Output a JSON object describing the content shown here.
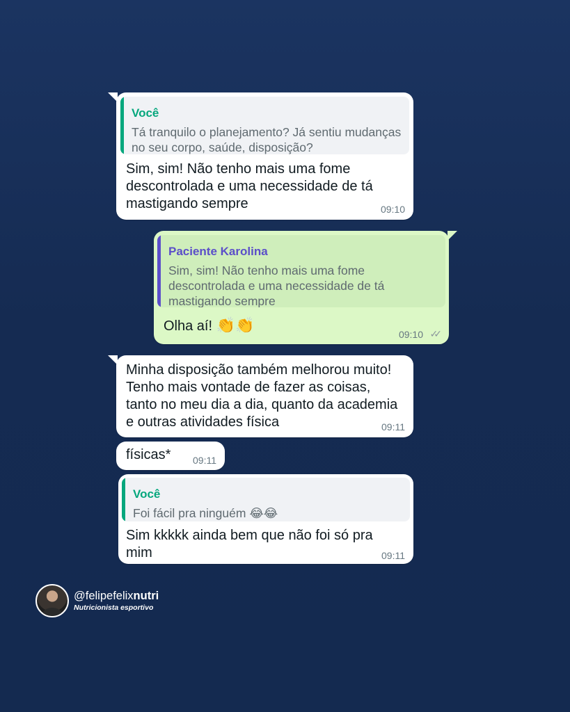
{
  "messages": [
    {
      "quote_author": "Você",
      "quote_text": "Tá tranquilo o planejamento? Já sentiu mudanças no seu corpo, saúde, disposição?",
      "text": "Sim, sim! Não tenho mais uma fome descontrolada e uma necessidade de tá mastigando sempre",
      "time": "09:10"
    },
    {
      "quote_author": "Paciente Karolina",
      "quote_text": "Sim, sim! Não tenho mais uma fome descontrolada e uma necessidade de tá mastigando sempre",
      "text": "Olha aí!",
      "emoji": "👏👏",
      "time": "09:10",
      "ticks": "✓✓"
    },
    {
      "text": "Minha disposição também melhorou muito! Tenho mais vontade de fazer as coisas, tanto no meu dia a dia, quanto da academia e outras atividades física",
      "time": "09:11"
    },
    {
      "text": "físicas*",
      "time": "09:11"
    },
    {
      "quote_author": "Você",
      "quote_text": "Foi fácil pra ninguém",
      "quote_emoji": "😂😂",
      "text": "Sim kkkkk ainda bem que não foi só pra mim",
      "time": "09:11"
    }
  ],
  "profile": {
    "handle_prefix": "@felipefelix",
    "handle_suffix": "nutri",
    "role": "Nutricionista esportivo"
  },
  "colors": {
    "background": "#1b3461",
    "incoming_bubble": "#ffffff",
    "outgoing_bubble": "#dcf8c6",
    "quote_you": "#06a77d",
    "quote_patient": "#5b4ec9"
  }
}
